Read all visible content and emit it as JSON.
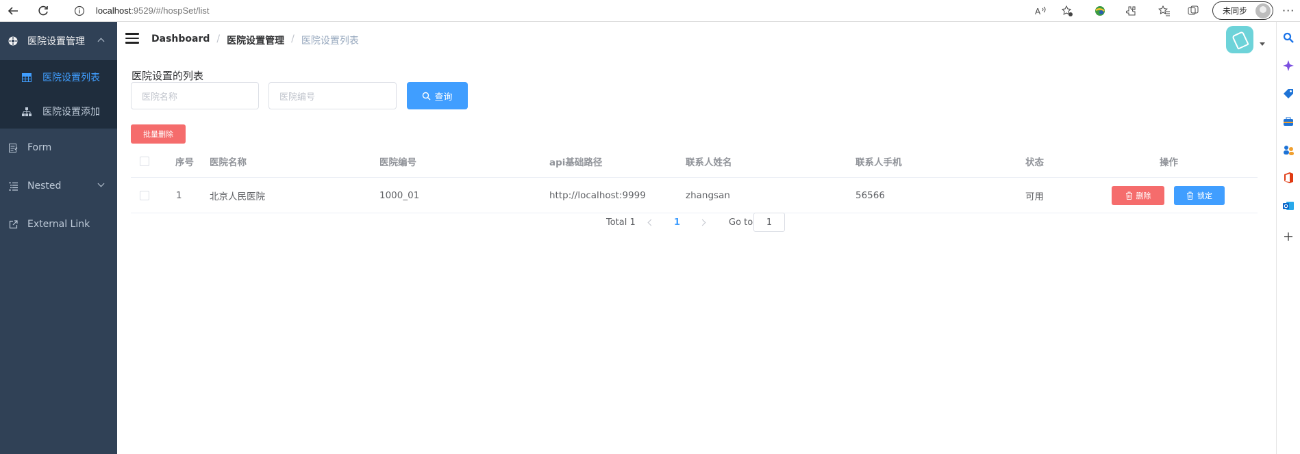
{
  "browser": {
    "url_host": "localhost",
    "url_rest": ":9529/#/hospSet/list",
    "sync_label": "未同步",
    "more_label": "···"
  },
  "sidebar": {
    "group_label": "医院设置管理",
    "sub_items": [
      {
        "label": "医院设置列表",
        "active": true
      },
      {
        "label": "医院设置添加",
        "active": false
      }
    ],
    "items": [
      {
        "label": "Form"
      },
      {
        "label": "Nested"
      },
      {
        "label": "External Link"
      }
    ]
  },
  "breadcrumb": {
    "root": "Dashboard",
    "parent": "医院设置管理",
    "current": "医院设置列表",
    "separator": "/"
  },
  "page": {
    "title": "医院设置的列表",
    "search_name_placeholder": "医院名称",
    "search_code_placeholder": "医院编号",
    "query_label": "查询",
    "batch_delete_label": "批量删除"
  },
  "table": {
    "headers": [
      "序号",
      "医院名称",
      "医院编号",
      "api基础路径",
      "联系人姓名",
      "联系人手机",
      "状态",
      "操作"
    ],
    "rows": [
      {
        "index": "1",
        "name": "北京人民医院",
        "code": "1000_01",
        "api": "http://localhost:9999",
        "contact": "zhangsan",
        "phone": "56566",
        "status": "可用"
      }
    ],
    "delete_label": "删除",
    "lock_label": "锁定"
  },
  "pagination": {
    "total_label": "Total 1",
    "current_page": "1",
    "goto_label": "Go to",
    "goto_value": "1"
  },
  "colors": {
    "sidebar_bg": "#304156",
    "submenu_bg": "#1f2d3d",
    "primary": "#409eff",
    "danger": "#f56c6c"
  }
}
